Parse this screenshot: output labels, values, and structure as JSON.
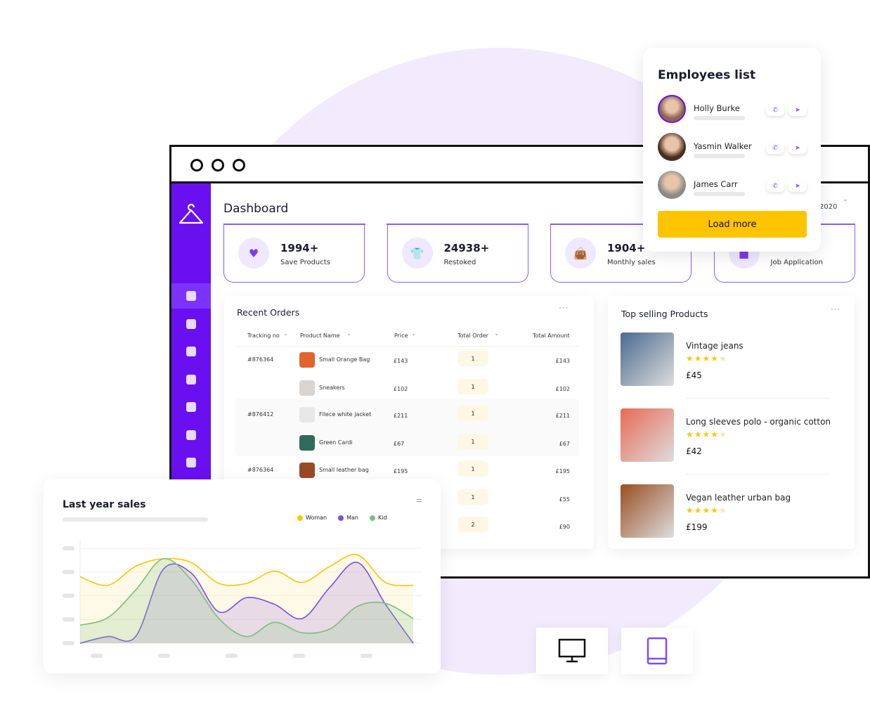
{
  "dashboard": {
    "title": "Dashboard",
    "year": "2020"
  },
  "stats": [
    {
      "value": "1994+",
      "label": "Save Products",
      "icon": "heart-icon"
    },
    {
      "value": "24938+",
      "label": "Restoked",
      "icon": "shirt-icon"
    },
    {
      "value": "1904+",
      "label": "Monthly sales",
      "icon": "bag-icon"
    },
    {
      "value": "",
      "label": "Job Application",
      "icon": "briefcase-icon"
    }
  ],
  "sidebar": {
    "items": [
      "grid-icon",
      "chart-icon",
      "apps-icon",
      "document-icon",
      "calendar-icon",
      "trend-icon",
      "bell-icon"
    ],
    "active": 0
  },
  "orders": {
    "title": "Recent Orders",
    "headers": [
      "Tracking no",
      "Product Name",
      "Price",
      "Total Order",
      "Total Amount"
    ],
    "rows": [
      {
        "tracking": "#876364",
        "product": "Small Orange Bag",
        "price": "£143",
        "qty": "1",
        "amount": "£143",
        "thumb": "#e2632b"
      },
      {
        "tracking": "",
        "product": "Sneakers",
        "price": "£102",
        "qty": "1",
        "amount": "£102",
        "thumb": "#d9d4cf"
      },
      {
        "tracking": "#876412",
        "product": "Fllece white jacket",
        "price": "£211",
        "qty": "1",
        "amount": "£211",
        "thumb": "#e8e8e8"
      },
      {
        "tracking": "",
        "product": "Green Cardi",
        "price": "£67",
        "qty": "1",
        "amount": "£67",
        "thumb": "#2f6b5a"
      },
      {
        "tracking": "#876364",
        "product": "Small leather bag",
        "price": "£195",
        "qty": "1",
        "amount": "£195",
        "thumb": "#9a4a25"
      },
      {
        "tracking": "",
        "product": "",
        "price": "",
        "qty": "1",
        "amount": "£55",
        "thumb": ""
      },
      {
        "tracking": "",
        "product": "",
        "price": "",
        "qty": "2",
        "amount": "£90",
        "thumb": ""
      }
    ]
  },
  "top_selling": {
    "title": "Top selling Products",
    "items": [
      {
        "name": "Vintage jeans",
        "price": "£45",
        "rating": 4,
        "color": "#4a6a8f"
      },
      {
        "name": "Long sleeves polo - organic cotton",
        "price": "£42",
        "rating": 4,
        "color": "#e86a55"
      },
      {
        "name": "Vegan leather urban bag",
        "price": "£199",
        "rating": 4,
        "color": "#9a4e22"
      }
    ]
  },
  "employees": {
    "title": "Employees list",
    "people": [
      {
        "name": "Holly Burke",
        "color": "#8d6550"
      },
      {
        "name": "Yasmin Walker",
        "color": "#4a2d20"
      },
      {
        "name": "James Carr",
        "color": "#8a8a8a"
      }
    ],
    "load_more": "Load more"
  },
  "chart_data": {
    "type": "area",
    "title": "Last year sales",
    "legend_position": "top-right",
    "grid": true,
    "ylim": [
      0,
      100
    ],
    "series": [
      {
        "name": "Woman",
        "color": "#ffc400",
        "values": [
          70,
          61,
          81,
          89,
          85,
          63,
          63,
          76,
          64,
          81,
          93,
          64,
          61
        ]
      },
      {
        "name": "Man",
        "color": "#7b4fe0",
        "values": [
          0,
          7,
          7,
          78,
          74,
          33,
          48,
          41,
          26,
          59,
          85,
          41,
          0
        ]
      },
      {
        "name": "Kid",
        "color": "#7dbd7d",
        "values": [
          19,
          27,
          56,
          89,
          67,
          26,
          7,
          22,
          11,
          15,
          39,
          42,
          26
        ]
      }
    ]
  }
}
